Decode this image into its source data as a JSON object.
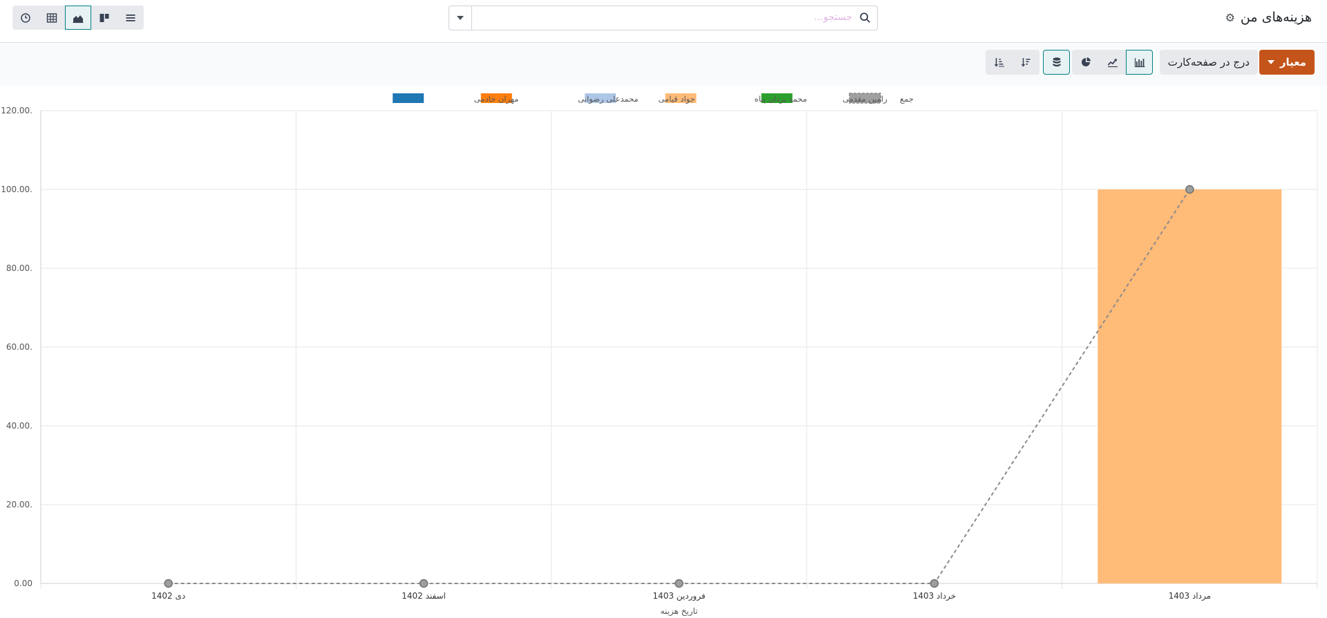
{
  "header": {
    "title": "هزینه‌های من",
    "gear_icon": "gear-icon",
    "search_placeholder": "جستجو...",
    "view_buttons": [
      "activity",
      "pivot",
      "graph",
      "kanban",
      "list"
    ]
  },
  "toolbar": {
    "measure_label": "معیار",
    "insert_label": "درج در صفحه‌کارت",
    "chart_types": [
      "bar",
      "line",
      "pie"
    ],
    "active_chart_type": "bar",
    "stacked": true,
    "sort_buttons": [
      "sort-descending",
      "sort-ascending"
    ]
  },
  "colors": {
    "accent": "#c4541a",
    "primary_active": "#017e84"
  },
  "chart_data": {
    "type": "bar",
    "stacked": true,
    "xlabel": "تاریخ هزینه",
    "ylabel": "",
    "ylim": [
      0,
      120
    ],
    "y_ticks": [
      "0.00",
      "20.00.",
      "40.00.",
      "60.00.",
      "80.00.",
      "100.00.",
      "120.00."
    ],
    "categories": [
      "دی 1402",
      "اسفند 1402",
      "فروردین 1403",
      "خرداد 1403",
      "مرداد 1403"
    ],
    "legend_position": "top",
    "grid": true,
    "series": [
      {
        "name": "جمع",
        "kind": "line",
        "color": "#a3a3a3",
        "values": [
          0,
          0,
          0,
          0,
          100
        ]
      },
      {
        "name": "رامین مقدمی",
        "color": "#2ca02c",
        "values": [
          0,
          0,
          0,
          0,
          0
        ]
      },
      {
        "name": "محمد یزدان پناه",
        "color": "#ffbb78",
        "values": [
          0,
          0,
          0,
          0,
          100
        ]
      },
      {
        "name": "جواد قیامی",
        "color": "#aec7e8",
        "values": [
          0,
          0,
          0,
          0,
          0
        ]
      },
      {
        "name": "محمدعلی رضوانی",
        "color": "#ff7f0e",
        "values": [
          0,
          0,
          0,
          0,
          0
        ]
      },
      {
        "name": "مهران خادمی",
        "color": "#1f77b4",
        "values": [
          0,
          0,
          0,
          0,
          0
        ]
      }
    ]
  }
}
